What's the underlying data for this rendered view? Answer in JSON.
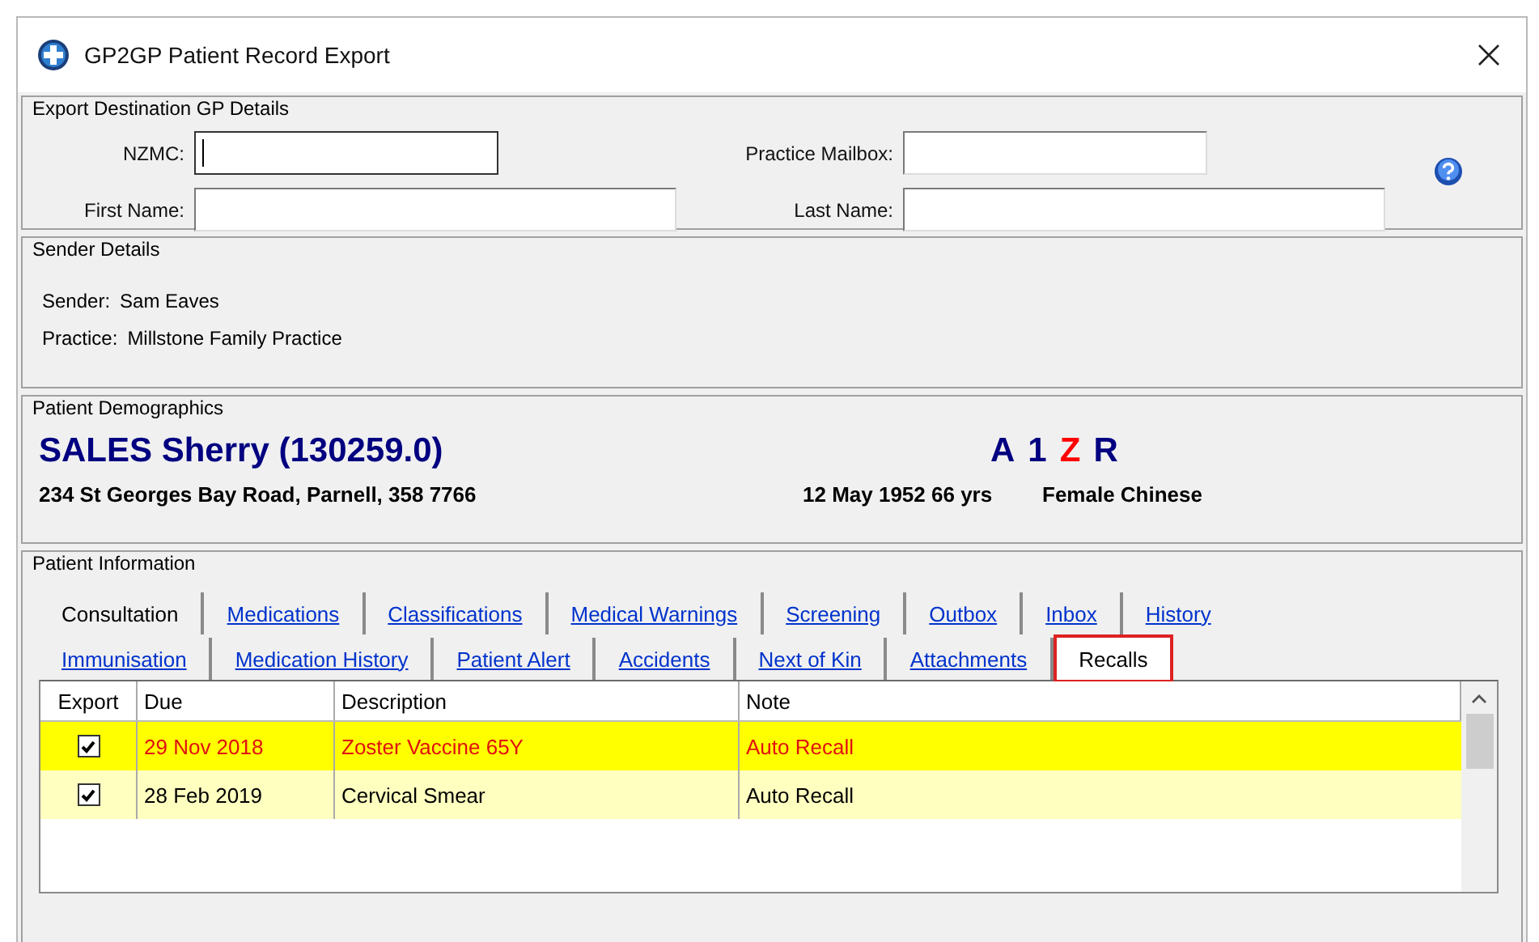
{
  "window": {
    "title": "GP2GP Patient Record Export"
  },
  "destination": {
    "legend": "Export Destination GP Details",
    "fields": [
      {
        "label": "NZMC:",
        "focused": true
      },
      {
        "label": "Practice Mailbox:",
        "focused": false
      },
      {
        "label": "First Name:",
        "focused": false
      },
      {
        "label": "Last Name:",
        "focused": false
      }
    ]
  },
  "sender": {
    "legend": "Sender Details",
    "lines": [
      {
        "label": "Sender:",
        "value": "Sam Eaves"
      },
      {
        "label": "Practice:",
        "value": "Millstone Family Practice"
      }
    ]
  },
  "demographics": {
    "legend": "Patient Demographics",
    "name": "SALES Sherry (130259.0)",
    "flags": [
      {
        "text": "A",
        "color": "#000080"
      },
      {
        "text": "1",
        "color": "#000080"
      },
      {
        "text": "Z",
        "color": "#ff0000"
      },
      {
        "text": "R",
        "color": "#000080"
      }
    ],
    "address": "234 St Georges Bay Road, Parnell, 358 7766",
    "dob": "12 May 1952 66 yrs",
    "sex_ethnicity": "Female Chinese"
  },
  "patient_info": {
    "legend": "Patient Information",
    "tab_rows": [
      [
        {
          "label": "Consultation",
          "selected": false,
          "kind": "plain"
        },
        {
          "label": "Medications",
          "selected": false,
          "kind": "link"
        },
        {
          "label": "Classifications",
          "selected": false,
          "kind": "link"
        },
        {
          "label": "Medical Warnings",
          "selected": false,
          "kind": "link"
        },
        {
          "label": "Screening",
          "selected": false,
          "kind": "link"
        },
        {
          "label": "Outbox",
          "selected": false,
          "kind": "link"
        },
        {
          "label": "Inbox",
          "selected": false,
          "kind": "link"
        },
        {
          "label": "History",
          "selected": false,
          "kind": "link"
        }
      ],
      [
        {
          "label": "Immunisation",
          "selected": false,
          "kind": "link"
        },
        {
          "label": "Medication History",
          "selected": false,
          "kind": "link"
        },
        {
          "label": "Patient Alert",
          "selected": false,
          "kind": "link"
        },
        {
          "label": "Accidents",
          "selected": false,
          "kind": "link"
        },
        {
          "label": "Next of Kin",
          "selected": false,
          "kind": "link"
        },
        {
          "label": "Attachments",
          "selected": false,
          "kind": "link"
        },
        {
          "label": "Recalls",
          "selected": true,
          "kind": "plain"
        }
      ]
    ],
    "table": {
      "columns": [
        "Export",
        "Due",
        "Description",
        "Note"
      ],
      "rows": [
        {
          "export": true,
          "kind": "overdue",
          "cells": [
            "",
            "29 Nov 2018",
            "Zoster Vaccine 65Y",
            "Auto Recall"
          ]
        },
        {
          "export": true,
          "kind": "due",
          "cells": [
            "",
            "28 Feb 2019",
            "Cervical Smear",
            "Auto Recall"
          ]
        }
      ]
    }
  }
}
